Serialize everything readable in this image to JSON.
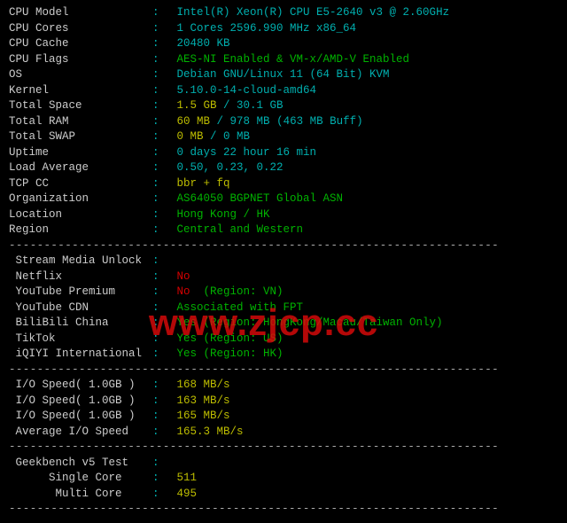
{
  "sys": {
    "cpu_model_lbl": "CPU Model",
    "cpu_model_val": "Intel(R) Xeon(R) CPU E5-2640 v3 @ 2.60GHz",
    "cpu_cores_lbl": "CPU Cores",
    "cpu_cores_val": "1 Cores 2596.990 MHz x86_64",
    "cpu_cache_lbl": "CPU Cache",
    "cpu_cache_val": "20480 KB",
    "cpu_flags_lbl": "CPU Flags",
    "cpu_flags_val": "AES-NI Enabled & VM-x/AMD-V Enabled",
    "os_lbl": "OS",
    "os_val": "Debian GNU/Linux 11 (64 Bit) KVM",
    "kernel_lbl": "Kernel",
    "kernel_val": "5.10.0-14-cloud-amd64",
    "space_lbl": "Total Space",
    "space_used": "1.5 GB",
    "space_slash": " / ",
    "space_total": "30.1 GB",
    "ram_lbl": "Total RAM",
    "ram_used": "60 MB",
    "ram_slash": " / ",
    "ram_total": "978 MB",
    "ram_buff": " (463 MB Buff)",
    "swap_lbl": "Total SWAP",
    "swap_used": "0 MB",
    "swap_slash": " / ",
    "swap_total": "0 MB",
    "uptime_lbl": "Uptime",
    "uptime_val": "0 days 22 hour 16 min",
    "load_lbl": "Load Average",
    "load_val": "0.50, 0.23, 0.22",
    "tcp_lbl": "TCP CC",
    "tcp_val": "bbr + fq",
    "org_lbl": "Organization",
    "org_val": "AS64050 BGPNET Global ASN",
    "loc_lbl": "Location",
    "loc_val": "Hong Kong / HK",
    "reg_lbl": "Region",
    "reg_val": "Central and Western"
  },
  "media": {
    "header": " Stream Media Unlock",
    "netflix_lbl": " Netflix",
    "netflix_val": "No",
    "ytp_lbl": " YouTube Premium",
    "ytp_val": "No",
    "ytp_extra": "  (Region: VN)",
    "ytc_lbl": " YouTube CDN",
    "ytc_val": "Associated with FPT",
    "bili_lbl": " BiliBili China",
    "bili_val": "Yes (Region: HongKong/Macau/Taiwan Only)",
    "tiktok_lbl": " TikTok",
    "tiktok_val": "Yes (Region: US)",
    "iqiyi_lbl": " iQIYI International",
    "iqiyi_val": "Yes (Region: HK)"
  },
  "io": {
    "s1_lbl": " I/O Speed( 1.0GB )",
    "s1_val": "168 MB/s",
    "s2_lbl": " I/O Speed( 1.0GB )",
    "s2_val": "163 MB/s",
    "s3_lbl": " I/O Speed( 1.0GB )",
    "s3_val": "165 MB/s",
    "avg_lbl": " Average I/O Speed",
    "avg_val": "165.3 MB/s"
  },
  "gb": {
    "header_lbl": " Geekbench v5 Test",
    "single_lbl": "      Single Core",
    "single_val": "511",
    "multi_lbl": "       Multi Core",
    "multi_val": "495"
  },
  "dash_line": "----------------------------------------------------------------------",
  "watermark": "www.zjcp.cc"
}
